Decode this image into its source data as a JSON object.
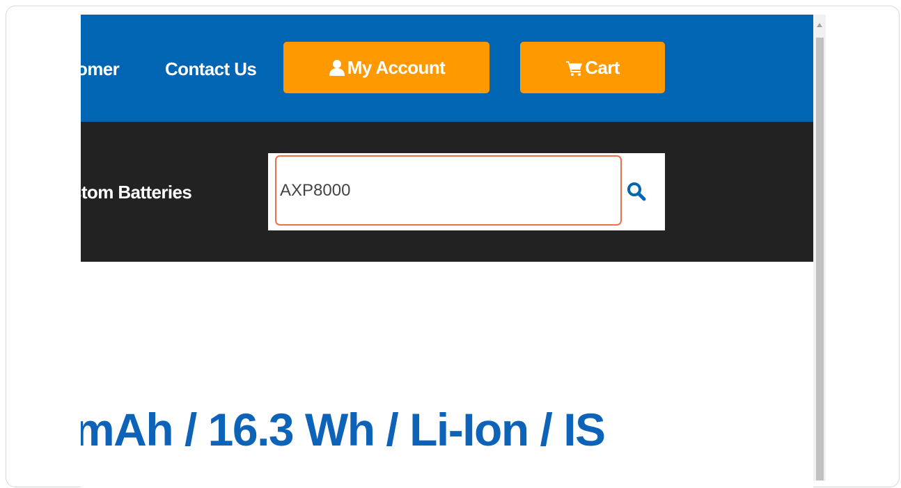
{
  "header": {
    "nav_links": [
      "omer",
      "Contact Us"
    ],
    "account_label": "My Account",
    "cart_label": "Cart"
  },
  "navbar": {
    "item_label": "stom Batteries"
  },
  "search": {
    "value": "AXP8000"
  },
  "product": {
    "heading": "mAh / 16.3 Wh / Li-Ion / IS"
  },
  "colors": {
    "brand_blue": "#0066b3",
    "accent_orange": "#ff9900",
    "nav_dark": "#222222",
    "heading_blue": "#0d63b8",
    "highlight": "#ee6f47"
  },
  "icons": {
    "account": "user-icon",
    "cart": "cart-icon",
    "search": "search-icon",
    "scroll": "scroll-up-icon"
  }
}
